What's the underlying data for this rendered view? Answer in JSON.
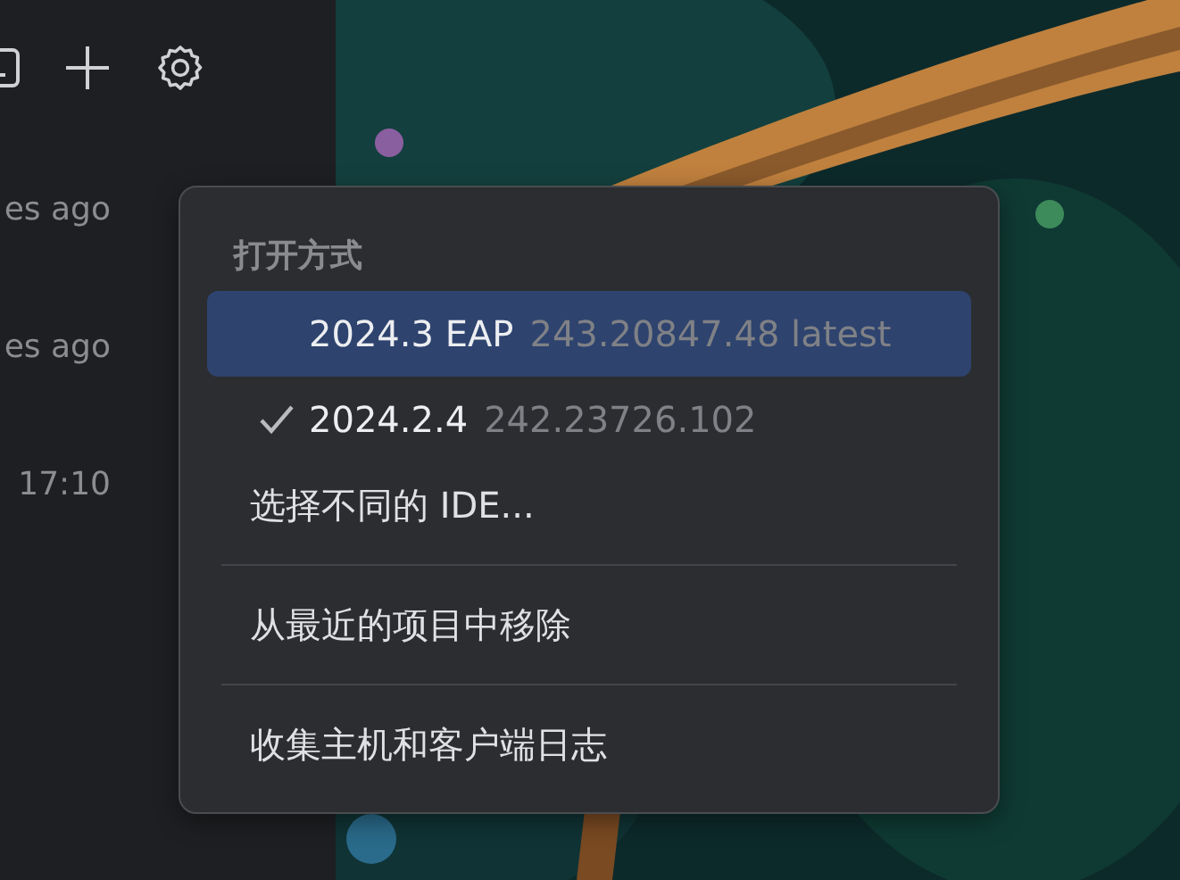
{
  "sidebar": {
    "items": [
      {
        "time": "es ago"
      },
      {
        "time": "es ago"
      },
      {
        "time": "17:10"
      }
    ]
  },
  "context_menu": {
    "heading": "打开方式",
    "items": [
      {
        "kind": "version",
        "name": "2024.3 EAP",
        "detail": "243.20847.48 latest",
        "selected": true,
        "checked": false
      },
      {
        "kind": "version",
        "name": "2024.2.4",
        "detail": "242.23726.102",
        "selected": false,
        "checked": true
      },
      {
        "kind": "action",
        "label": "选择不同的 IDE..."
      },
      {
        "kind": "separator"
      },
      {
        "kind": "action",
        "label": "从最近的项目中移除"
      },
      {
        "kind": "separator"
      },
      {
        "kind": "action",
        "label": "收集主机和客户端日志"
      }
    ]
  }
}
